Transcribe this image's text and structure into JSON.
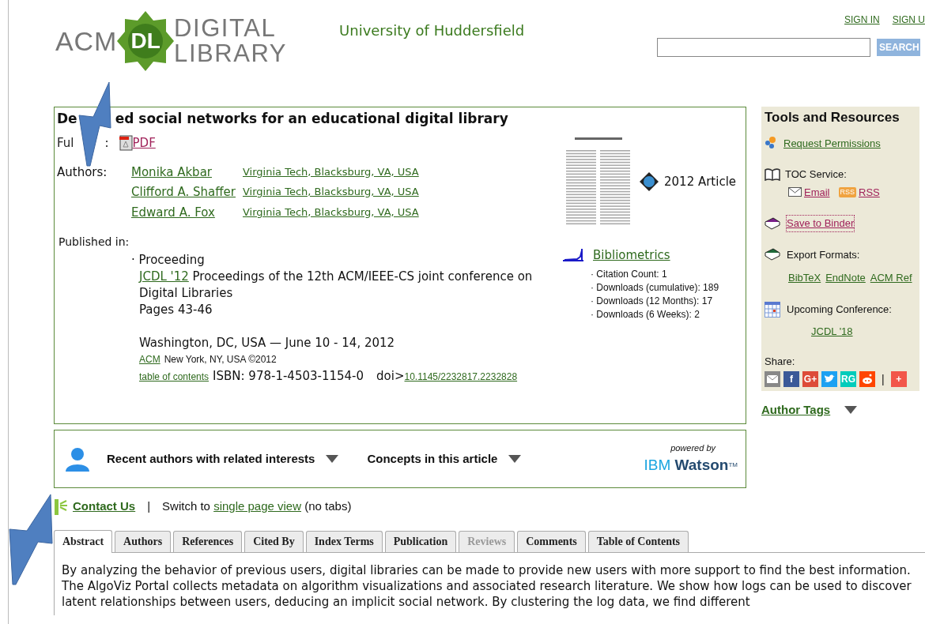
{
  "header": {
    "logo": {
      "left": "ACM",
      "badge": "DL",
      "line1": "DIGITAL",
      "line2": "LIBRARY"
    },
    "institution": "University of Huddersfield",
    "links": [
      "SIGN IN",
      "SIGN U"
    ],
    "search_button": "SEARCH"
  },
  "article": {
    "title_parts": [
      "De",
      "ed social networks for an educational digital library"
    ],
    "fulltext_label_parts": [
      "Ful",
      ":"
    ],
    "pdf_link": "PDF",
    "authors_label": "Authors:",
    "authors": [
      {
        "name": "Monika Akbar",
        "affiliation": "Virginia Tech, Blacksburg, VA, USA"
      },
      {
        "name": "Clifford A. Shaffer",
        "affiliation": "Virginia Tech, Blacksburg, VA, USA"
      },
      {
        "name": "Edward A. Fox",
        "affiliation": "Virginia Tech, Blacksburg, VA, USA"
      }
    ],
    "type_label": "2012 Article",
    "published_label": "Published in:",
    "proceeding_bullet": "· Proceeding",
    "venue_link": "JCDL '12",
    "venue_text": "Proceedings of the 12th ACM/IEEE-CS joint conference on Digital Libraries",
    "pages": "Pages 43-46",
    "location": "Washington, DC, USA — June 10 - 14, 2012",
    "publisher_link": "ACM",
    "publisher_text": "New York, NY, USA ©2012",
    "toc_link": "table of contents",
    "isbn": "ISBN: 978-1-4503-1154-0",
    "doi_label": "doi>",
    "doi_link": "10.1145/2232817.2232828",
    "bibliometrics": {
      "title": "Bibliometrics",
      "items": [
        "· Citation Count: 1",
        "· Downloads (cumulative): 189",
        "· Downloads (12 Months): 17",
        "· Downloads (6 Weeks): 2"
      ]
    }
  },
  "tools": {
    "title": "Tools and Resources",
    "request": "Request Permissions",
    "toc_label": "TOC Service:",
    "email": "Email",
    "rss_badge": "RSS",
    "rss": "RSS",
    "binder": "Save to Binder",
    "export_label": "Export Formats:",
    "exports": [
      "BibTeX",
      "EndNote",
      "ACM Ref"
    ],
    "conf_label": "Upcoming Conference:",
    "conf_link": "JCDL '18",
    "share_label": "Share:",
    "share": [
      {
        "kind": "mail",
        "color": "#888888"
      },
      {
        "kind": "text",
        "label": "f",
        "color": "#3b5998"
      },
      {
        "kind": "text",
        "label": "G+",
        "color": "#dd4b39"
      },
      {
        "kind": "bird",
        "color": "#1da1f2"
      },
      {
        "kind": "text",
        "label": "RG",
        "color": "#00ccbb"
      },
      {
        "kind": "alien",
        "color": "#ff4500"
      },
      {
        "kind": "sep",
        "label": "|"
      },
      {
        "kind": "text",
        "label": "+",
        "color": "#f2564a"
      }
    ]
  },
  "author_tags": "Author Tags",
  "watson": {
    "items": [
      "Recent authors with related interests",
      "Concepts in this article"
    ],
    "powered": "powered by",
    "brand1": "IBM",
    "brand2": "Watson",
    "tm": "TM"
  },
  "contact": {
    "link": "Contact Us",
    "sep": "|",
    "text1": "Switch to",
    "link2": "single page view",
    "text2": "(no tabs)"
  },
  "tabs": [
    {
      "label": "Abstract",
      "selected": true,
      "disabled": false
    },
    {
      "label": "Authors",
      "selected": false,
      "disabled": false
    },
    {
      "label": "References",
      "selected": false,
      "disabled": false
    },
    {
      "label": "Cited By",
      "selected": false,
      "disabled": false
    },
    {
      "label": "Index Terms",
      "selected": false,
      "disabled": false
    },
    {
      "label": "Publication",
      "selected": false,
      "disabled": false
    },
    {
      "label": "Reviews",
      "selected": false,
      "disabled": true
    },
    {
      "label": "Comments",
      "selected": false,
      "disabled": false
    },
    {
      "label": "Table of Contents",
      "selected": false,
      "disabled": false
    }
  ],
  "abstract": "By analyzing the behavior of previous users, digital libraries can be made to provide new users with more support to find the best information. The AlgoViz Portal collects metadata on algorithm visualizations and associated research literature. We show how logs can be used to discover latent relationships between users, deducing an implicit social network. By clustering the log data, we find different"
}
